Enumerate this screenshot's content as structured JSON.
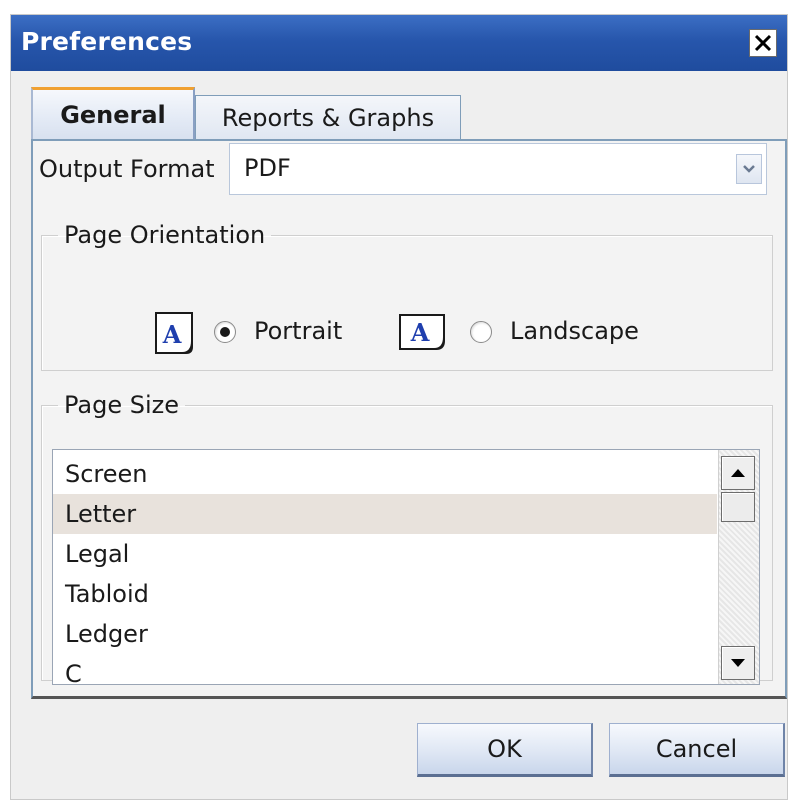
{
  "window": {
    "title": "Preferences",
    "close_glyph": "✕"
  },
  "tabs": [
    {
      "label": "General",
      "active": true
    },
    {
      "label": "Reports & Graphs",
      "active": false
    }
  ],
  "output_format": {
    "label": "Output Format",
    "value": "PDF"
  },
  "page_orientation": {
    "legend": "Page Orientation",
    "icon_letter": "A",
    "options": [
      {
        "label": "Portrait",
        "selected": true
      },
      {
        "label": "Landscape",
        "selected": false
      }
    ]
  },
  "page_size": {
    "legend": "Page Size",
    "items": [
      {
        "label": "Screen",
        "selected": false
      },
      {
        "label": "Letter",
        "selected": true
      },
      {
        "label": "Legal",
        "selected": false
      },
      {
        "label": "Tabloid",
        "selected": false
      },
      {
        "label": "Ledger",
        "selected": false
      },
      {
        "label": "C",
        "selected": false
      }
    ]
  },
  "buttons": {
    "ok": "OK",
    "cancel": "Cancel"
  },
  "colors": {
    "titlebar": "#2756ac",
    "selected_row": "#e8e2dc",
    "tab_accent": "#f0a030"
  }
}
